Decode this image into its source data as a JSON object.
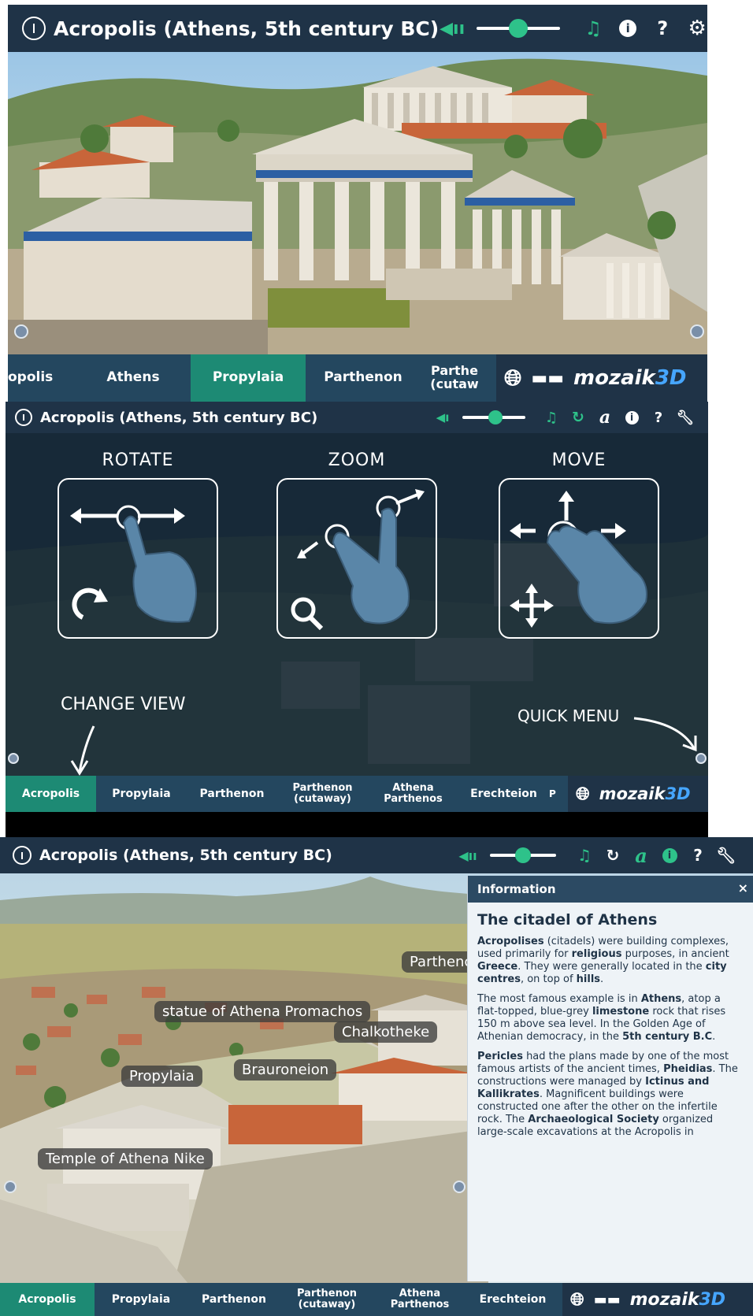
{
  "app_title": "Acropolis (Athens, 5th century BC)",
  "brand": {
    "name": "mozaik",
    "suffix": "3D"
  },
  "volume_level": 0.5,
  "panel1": {
    "tabs": [
      "opolis",
      "Athens",
      "Propylaia",
      "Parthenon",
      "Parthe\n(cutaw"
    ],
    "active_tab": "Propylaia"
  },
  "panel2": {
    "tabs": [
      "Acropolis",
      "Propylaia",
      "Parthenon",
      "Parthenon\n(cutaway)",
      "Athena\nParthenos",
      "Erechteion",
      "P"
    ],
    "active_tab": "Acropolis",
    "gestures": {
      "rotate": "ROTATE",
      "zoom": "ZOOM",
      "move": "MOVE"
    },
    "hints": {
      "change_view": "CHANGE VIEW",
      "quick_menu": "QUICK MENU"
    }
  },
  "panel3": {
    "tabs": [
      "Acropolis",
      "Propylaia",
      "Parthenon",
      "Parthenon\n(cutaway)",
      "Athena\nParthenos",
      "Erechteion"
    ],
    "active_tab": "Acropolis",
    "labels": {
      "parthenon": "Parthenc",
      "promachos": "statue of Athena Promachos",
      "chalkotheke": "Chalkotheke",
      "propylaia": "Propylaia",
      "brauroneion": "Brauroneion",
      "nike": "Temple of Athena Nike"
    },
    "info": {
      "header": "Information",
      "close": "×",
      "heading": "The citadel of Athens",
      "p1": "<b>Acropolises</b> (citadels) were building complexes, used primarily for <b>religious</b> purposes, in ancient <b>Greece</b>. They were generally located in the <b>city centres</b>, on top of <b>hills</b>.",
      "p2": "The most famous example is in <b>Athens</b>, atop a flat-topped, blue-grey <b>limestone</b> rock that rises 150 m above sea level. In the Golden Age of Athenian democracy, in the <b>5th century B.C</b>.",
      "p3": "<b>Pericles</b> had the plans made by one of the most famous artists of the ancient times, <b>Pheidias</b>. The constructions were managed by <b>Ictinus and Kallikrates</b>. Magnificent buildings were constructed one after the other on the infertile rock. The <b>Archaeological Society</b> organized large-scale excavations at the Acropolis in"
    }
  },
  "colors": {
    "bar": "#1f3347",
    "tabbar": "#24475f",
    "accent": "#2ec28a",
    "active_tab": "#1d8a74",
    "brand_3d": "#46a6ff"
  }
}
